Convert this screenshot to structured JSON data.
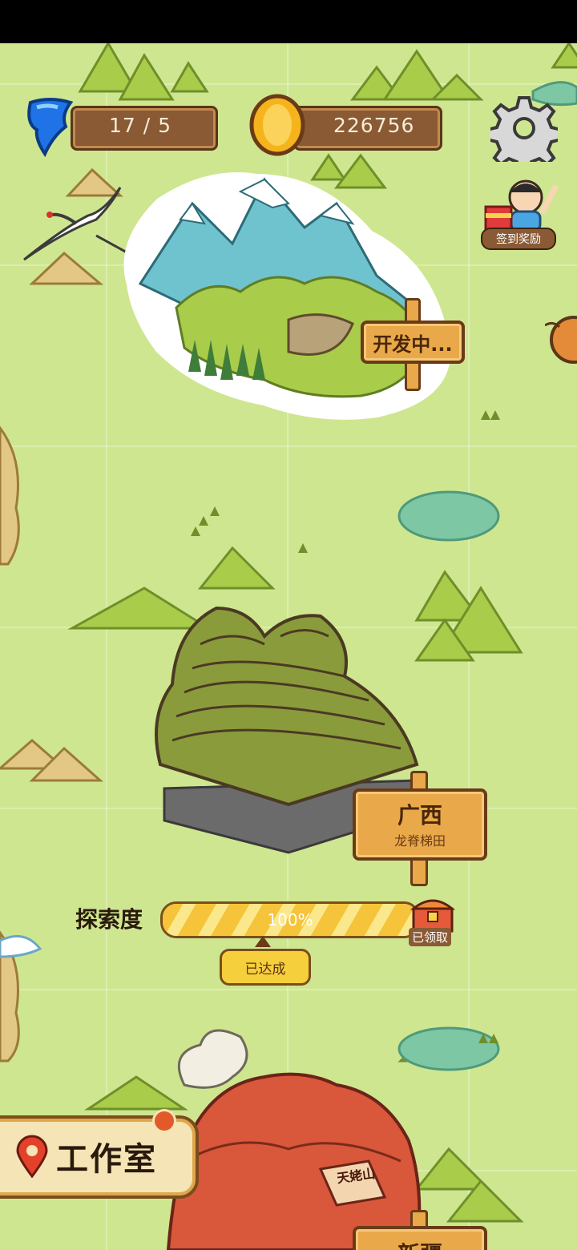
{
  "hud": {
    "energy": "17 / 5",
    "coins": "226756"
  },
  "checkin": {
    "label": "签到奖励"
  },
  "regions": {
    "snow_mountain": {
      "sign": "开发中..."
    },
    "guangxi": {
      "name": "广西",
      "subtitle": "龙脊梯田",
      "progress_label": "探索度",
      "progress_value": "100%",
      "progress_fraction": 1.0,
      "chest_label": "已领取",
      "achieved_label": "已达成"
    },
    "next_region": {
      "mountain_name": "天姥山",
      "sign": "新疆"
    }
  },
  "studio": {
    "label": "工作室"
  },
  "colors": {
    "grass": "#cfe690",
    "wood": "#e9a94a",
    "wood_dark": "#6a3b16",
    "hud_bar": "#8a5a34",
    "energy_blue": "#1f73e6",
    "coin_gold": "#f6b41c",
    "progress_yellow": "#f6c43a"
  }
}
